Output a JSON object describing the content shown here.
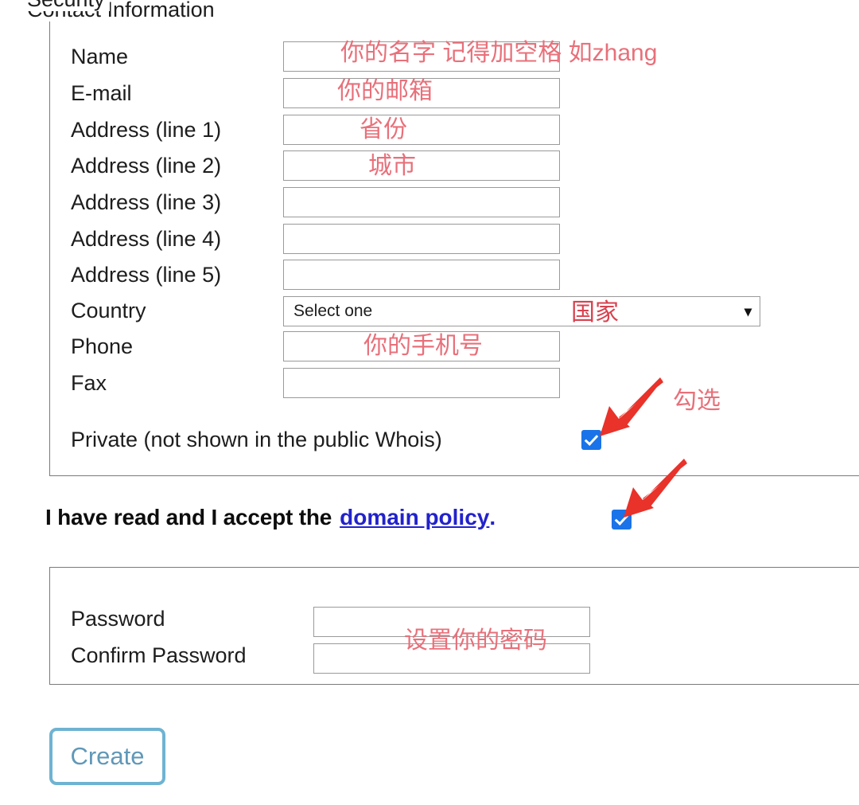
{
  "contact": {
    "legend": "Contact Information",
    "rows": [
      {
        "label": "Name",
        "type": "text",
        "value": ""
      },
      {
        "label": "E-mail",
        "type": "text",
        "value": ""
      },
      {
        "label": "Address (line 1)",
        "type": "text",
        "value": ""
      },
      {
        "label": "Address (line 2)",
        "type": "text",
        "value": ""
      },
      {
        "label": "Address (line 3)",
        "type": "text",
        "value": ""
      },
      {
        "label": "Address (line 4)",
        "type": "text",
        "value": ""
      },
      {
        "label": "Address (line 5)",
        "type": "text",
        "value": ""
      },
      {
        "label": "Country",
        "type": "select",
        "value": "Select one"
      },
      {
        "label": "Phone",
        "type": "text",
        "value": ""
      },
      {
        "label": "Fax",
        "type": "text",
        "value": ""
      }
    ],
    "private": {
      "label": "Private (not shown in the public Whois)",
      "checked": true
    }
  },
  "policy": {
    "text": "I have read and I accept the",
    "link_label": "domain policy",
    "period": ".",
    "checked": true
  },
  "security": {
    "legend": "Security",
    "rows": [
      {
        "label": "Password",
        "value": ""
      },
      {
        "label": "Confirm Password",
        "value": ""
      }
    ]
  },
  "submit": {
    "label": "Create"
  },
  "annotations": {
    "name": "你的名字 记得加空格 如zhang",
    "email": "你的邮箱",
    "address1": "省份",
    "address2": "城市",
    "country": "国家",
    "phone": "你的手机号",
    "check": "勾选",
    "password": "设置你的密码"
  },
  "colors": {
    "annotation": "#e8707a",
    "annotation_strong": "#d9424f",
    "arrow": "#e8322a",
    "checkbox": "#1a73e8",
    "link": "#2222cc",
    "button_border": "#6fb3d2",
    "button_text": "#6098b8",
    "field_border": "#9a9a9a",
    "fieldset_border": "#7a7a7a"
  }
}
